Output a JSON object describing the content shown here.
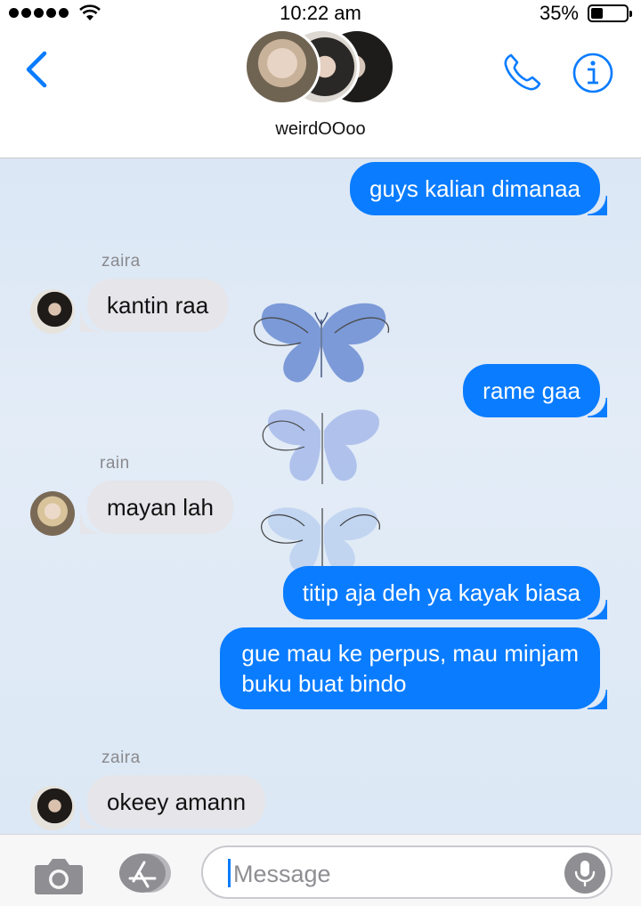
{
  "status_bar": {
    "time": "10:22 am",
    "battery_percent": "35%",
    "battery_level": 0.35,
    "signal_bars": 5
  },
  "header": {
    "group_name": "weirdOOoo",
    "avatars": [
      "group-member-1",
      "group-member-2",
      "group-member-3"
    ]
  },
  "messages": [
    {
      "direction": "outgoing",
      "text": "guys kalian dimanaa"
    },
    {
      "direction": "incoming",
      "sender": "zaira",
      "text": "kantin raa"
    },
    {
      "direction": "outgoing",
      "text": "rame gaa"
    },
    {
      "direction": "incoming",
      "sender": "rain",
      "text": "mayan lah"
    },
    {
      "direction": "outgoing",
      "text": "titip aja deh ya kayak biasa"
    },
    {
      "direction": "outgoing",
      "lines": [
        "gue mau ke perpus, mau minjam",
        "buku buat bindo"
      ]
    },
    {
      "direction": "incoming",
      "sender": "zaira",
      "text": "okeey amann"
    }
  ],
  "input_bar": {
    "placeholder": "Message"
  },
  "icons": {
    "back": "chevron-left-icon",
    "call": "phone-icon",
    "info": "info-icon",
    "camera": "camera-icon",
    "apps": "app-store-icon",
    "mic": "microphone-icon"
  },
  "colors": {
    "accent": "#0a7cff",
    "incoming_bubble": "#e5e5ea",
    "background": "#dde9f6"
  }
}
